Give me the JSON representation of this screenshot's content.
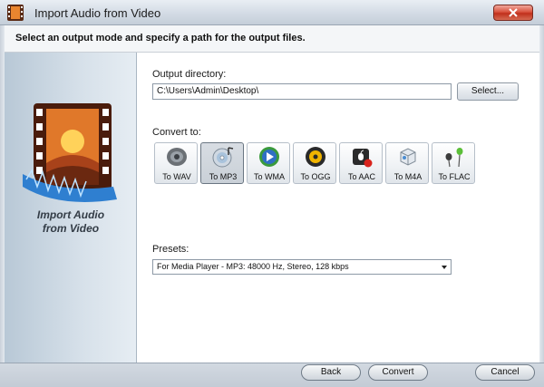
{
  "window": {
    "title": "Import Audio from Video",
    "close_icon": "close-x-icon"
  },
  "header": {
    "instruction": "Select an output mode and specify a path for the output files."
  },
  "side_panel": {
    "title_line1": "Import Audio",
    "title_line2": "from Video",
    "graphic": "film-strip-audio-icon"
  },
  "output": {
    "label": "Output directory:",
    "value": "C:\\Users\\Admin\\Desktop\\",
    "select_label": "Select..."
  },
  "convert": {
    "label": "Convert to:",
    "selected": "To MP3",
    "options": [
      {
        "label": "To WAV",
        "icon": "speaker-icon"
      },
      {
        "label": "To MP3",
        "icon": "cd-icon"
      },
      {
        "label": "To WMA",
        "icon": "media-player-icon"
      },
      {
        "label": "To OGG",
        "icon": "ogg-disc-icon"
      },
      {
        "label": "To AAC",
        "icon": "apple-device-icon"
      },
      {
        "label": "To M4A",
        "icon": "m4a-box-icon"
      },
      {
        "label": "To FLAC",
        "icon": "earphones-icon"
      }
    ]
  },
  "presets": {
    "label": "Presets:",
    "value": "For Media Player - MP3: 48000 Hz, Stereo, 128 kbps"
  },
  "footer": {
    "back_label": "Back",
    "convert_label": "Convert",
    "cancel_label": "Cancel"
  },
  "colors": {
    "close_red": "#c0301c",
    "panel_blue": "#b8c8d6",
    "film_orange": "#e0782a"
  }
}
